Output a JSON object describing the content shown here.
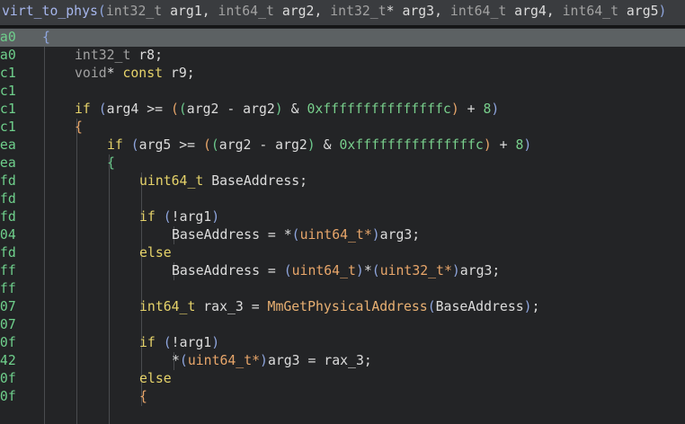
{
  "header": {
    "tokens": [
      {
        "t": "virt_to_phys",
        "c": "fname"
      },
      {
        "t": "(",
        "c": "p1"
      },
      {
        "t": "int32_t",
        "c": "type"
      },
      {
        "t": " arg1, ",
        "c": "def"
      },
      {
        "t": "int64_t",
        "c": "type"
      },
      {
        "t": " arg2, ",
        "c": "def"
      },
      {
        "t": "int32_t",
        "c": "type"
      },
      {
        "t": "* arg3, ",
        "c": "def"
      },
      {
        "t": "int64_t",
        "c": "type"
      },
      {
        "t": " arg4, ",
        "c": "def"
      },
      {
        "t": "int64_t",
        "c": "type"
      },
      {
        "t": " arg5",
        "c": "def"
      },
      {
        "t": ")",
        "c": "p1"
      }
    ]
  },
  "lines": [
    {
      "addr": "a0",
      "indent": 0,
      "hl": true,
      "tokens": [
        {
          "t": "{",
          "c": "p1"
        }
      ]
    },
    {
      "addr": "a0",
      "indent": 1,
      "tokens": [
        {
          "t": "int32_t",
          "c": "type"
        },
        {
          "t": " r8;",
          "c": "def"
        }
      ]
    },
    {
      "addr": "c1",
      "indent": 1,
      "tokens": [
        {
          "t": "void",
          "c": "type"
        },
        {
          "t": "* ",
          "c": "def"
        },
        {
          "t": "const",
          "c": "kw"
        },
        {
          "t": " r9;",
          "c": "def"
        }
      ]
    },
    {
      "addr": "c1",
      "indent": 1,
      "tokens": []
    },
    {
      "addr": "c1",
      "indent": 1,
      "tokens": [
        {
          "t": "if",
          "c": "kw"
        },
        {
          "t": " ",
          "c": "def"
        },
        {
          "t": "(",
          "c": "p1"
        },
        {
          "t": "arg4 >= ",
          "c": "def"
        },
        {
          "t": "(",
          "c": "p2"
        },
        {
          "t": "(",
          "c": "p3"
        },
        {
          "t": "arg2 - arg2",
          "c": "def"
        },
        {
          "t": ")",
          "c": "p3"
        },
        {
          "t": " & ",
          "c": "def"
        },
        {
          "t": "0xfffffffffffffffc",
          "c": "num"
        },
        {
          "t": ")",
          "c": "p2"
        },
        {
          "t": " + ",
          "c": "def"
        },
        {
          "t": "8",
          "c": "num"
        },
        {
          "t": ")",
          "c": "p1"
        }
      ]
    },
    {
      "addr": "c1",
      "indent": 1,
      "tokens": [
        {
          "t": "{",
          "c": "p2"
        }
      ]
    },
    {
      "addr": "ea",
      "indent": 2,
      "tokens": [
        {
          "t": "if",
          "c": "kw"
        },
        {
          "t": " ",
          "c": "def"
        },
        {
          "t": "(",
          "c": "p1"
        },
        {
          "t": "arg5 >= ",
          "c": "def"
        },
        {
          "t": "(",
          "c": "p2"
        },
        {
          "t": "(",
          "c": "p3"
        },
        {
          "t": "arg2 - arg2",
          "c": "def"
        },
        {
          "t": ")",
          "c": "p3"
        },
        {
          "t": " & ",
          "c": "def"
        },
        {
          "t": "0xfffffffffffffffc",
          "c": "num"
        },
        {
          "t": ")",
          "c": "p2"
        },
        {
          "t": " + ",
          "c": "def"
        },
        {
          "t": "8",
          "c": "num"
        },
        {
          "t": ")",
          "c": "p1"
        }
      ]
    },
    {
      "addr": "ea",
      "indent": 2,
      "tokens": [
        {
          "t": "{",
          "c": "p3"
        }
      ]
    },
    {
      "addr": "fd",
      "indent": 3,
      "tokens": [
        {
          "t": "uint64_t",
          "c": "kw"
        },
        {
          "t": " BaseAddress;",
          "c": "def"
        }
      ]
    },
    {
      "addr": "fd",
      "indent": 3,
      "tokens": []
    },
    {
      "addr": "fd",
      "indent": 3,
      "tokens": [
        {
          "t": "if",
          "c": "kw"
        },
        {
          "t": " ",
          "c": "def"
        },
        {
          "t": "(",
          "c": "p1"
        },
        {
          "t": "!arg1",
          "c": "def"
        },
        {
          "t": ")",
          "c": "p1"
        }
      ]
    },
    {
      "addr": "04",
      "indent": 4,
      "tokens": [
        {
          "t": "BaseAddress = *",
          "c": "def"
        },
        {
          "t": "(",
          "c": "p1"
        },
        {
          "t": "uint64_t*",
          "c": "p2"
        },
        {
          "t": ")",
          "c": "p1"
        },
        {
          "t": "arg3;",
          "c": "def"
        }
      ]
    },
    {
      "addr": "fd",
      "indent": 3,
      "tokens": [
        {
          "t": "else",
          "c": "kw"
        }
      ]
    },
    {
      "addr": "ff",
      "indent": 4,
      "tokens": [
        {
          "t": "BaseAddress = ",
          "c": "def"
        },
        {
          "t": "(",
          "c": "p1"
        },
        {
          "t": "uint64_t",
          "c": "p2"
        },
        {
          "t": ")",
          "c": "p1"
        },
        {
          "t": "*",
          "c": "def"
        },
        {
          "t": "(",
          "c": "p1"
        },
        {
          "t": "uint32_t*",
          "c": "p2"
        },
        {
          "t": ")",
          "c": "p1"
        },
        {
          "t": "arg3;",
          "c": "def"
        }
      ]
    },
    {
      "addr": "ff",
      "indent": 3,
      "tokens": []
    },
    {
      "addr": "07",
      "indent": 3,
      "tokens": [
        {
          "t": "int64_t",
          "c": "kw"
        },
        {
          "t": " rax_3 = ",
          "c": "def"
        },
        {
          "t": "MmGetPhysicalAddress",
          "c": "fn"
        },
        {
          "t": "(",
          "c": "p1"
        },
        {
          "t": "BaseAddress",
          "c": "def"
        },
        {
          "t": ")",
          "c": "p1"
        },
        {
          "t": ";",
          "c": "def"
        }
      ]
    },
    {
      "addr": "07",
      "indent": 3,
      "tokens": []
    },
    {
      "addr": "0f",
      "indent": 3,
      "tokens": [
        {
          "t": "if",
          "c": "kw"
        },
        {
          "t": " ",
          "c": "def"
        },
        {
          "t": "(",
          "c": "p1"
        },
        {
          "t": "!arg1",
          "c": "def"
        },
        {
          "t": ")",
          "c": "p1"
        }
      ]
    },
    {
      "addr": "42",
      "indent": 4,
      "tokens": [
        {
          "t": "*",
          "c": "def"
        },
        {
          "t": "(",
          "c": "p1"
        },
        {
          "t": "uint64_t*",
          "c": "p2"
        },
        {
          "t": ")",
          "c": "p1"
        },
        {
          "t": "arg3 = rax_3;",
          "c": "def"
        }
      ]
    },
    {
      "addr": "0f",
      "indent": 3,
      "tokens": [
        {
          "t": "else",
          "c": "kw"
        }
      ]
    },
    {
      "addr": "0f",
      "indent": 3,
      "tokens": [
        {
          "t": "{",
          "c": "p2"
        }
      ]
    }
  ]
}
